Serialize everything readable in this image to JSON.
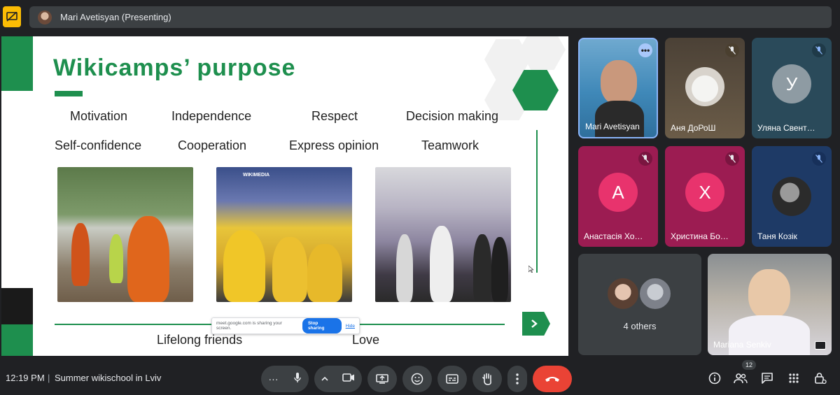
{
  "topbar": {
    "presenter_label": "Mari Avetisyan (Presenting)"
  },
  "slide": {
    "title": "Wikicamps’ purpose",
    "row1": [
      "Motivation",
      "Independence",
      "Respect",
      "Decision making"
    ],
    "row2": [
      "Self-confidence",
      "Cooperation",
      "Express opinion",
      "Teamwork"
    ],
    "row3": [
      "Lifelong friends",
      "Love"
    ],
    "photo_sign": "WIKIMEDIA",
    "share_bar": {
      "text": "meet.google.com is sharing your screen.",
      "stop_label": "Stop sharing",
      "hide_label": "Hide"
    }
  },
  "participants": [
    {
      "name": "Mari Avetisyan"
    },
    {
      "name": "Аня ДоРоШ"
    },
    {
      "name": "Уляна Свент…",
      "initial": "У"
    },
    {
      "name": "Анастасія Хо…",
      "initial": "А"
    },
    {
      "name": "Христина Бо…",
      "initial": "Х"
    },
    {
      "name": "Таня Козік"
    },
    {
      "name": "4 others"
    },
    {
      "name": "Mariana Senkiv"
    }
  ],
  "bottombar": {
    "time": "12:19 PM",
    "separator": "|",
    "meeting_name": "Summer wikischool in Lviv",
    "people_count": "12"
  },
  "colors": {
    "accent_green": "#1e8f4e",
    "end_call_red": "#ea4335",
    "presenting_yellow": "#fbbc04"
  },
  "icons": [
    "present-off-icon",
    "mic-icon",
    "chevron-up-icon",
    "camera-icon",
    "share-screen-icon",
    "emoji-icon",
    "captions-icon",
    "raise-hand-icon",
    "more-vert-icon",
    "end-call-icon",
    "info-icon",
    "people-icon",
    "chat-icon",
    "activities-icon",
    "host-controls-icon"
  ]
}
